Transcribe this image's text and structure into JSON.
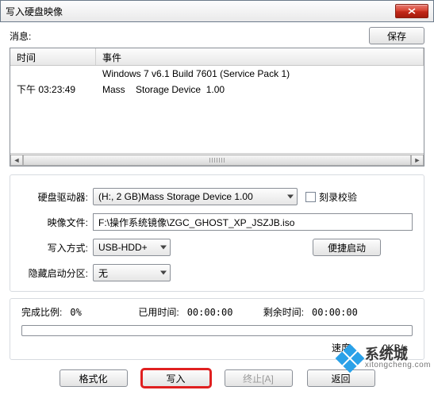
{
  "window": {
    "title": "写入硬盘映像"
  },
  "msg_label": "消息:",
  "save_btn": "保存",
  "table": {
    "headers": {
      "time": "时间",
      "event": "事件"
    },
    "rows": [
      {
        "time": "",
        "event": "Windows 7 v6.1 Build 7601 (Service Pack 1)"
      },
      {
        "time": "下午 03:23:49",
        "event": "Mass    Storage Device  1.00"
      }
    ]
  },
  "fields": {
    "drive_label": "硬盘驱动器:",
    "drive_value": "(H:, 2 GB)Mass    Storage Device  1.00  ",
    "verify_label": "刻录校验",
    "image_label": "映像文件:",
    "image_value": "F:\\操作系统镜像\\ZGC_GHOST_XP_JSZJB.iso",
    "mode_label": "写入方式:",
    "mode_value": "USB-HDD+",
    "quickboot_btn": "便捷启动",
    "hidden_label": "隐藏启动分区:",
    "hidden_value": "无"
  },
  "stats": {
    "done_label": "完成比例:",
    "done_value": "0%",
    "elapsed_label": "已用时间:",
    "elapsed_value": "00:00:00",
    "remain_label": "剩余时间:",
    "remain_value": "00:00:00",
    "speed_label": "速度:",
    "speed_value": "0KB/s"
  },
  "buttons": {
    "format": "格式化",
    "write": "写入",
    "abort": "终止[A]",
    "back": "返回"
  },
  "watermark": {
    "cn": "系统城",
    "en": "xitongcheng.com"
  }
}
